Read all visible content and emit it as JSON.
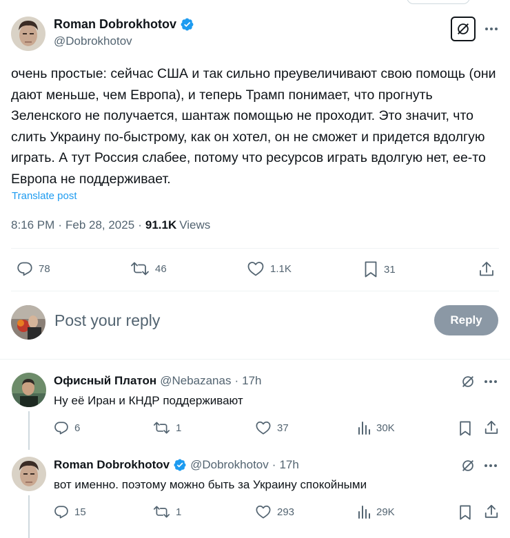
{
  "author": {
    "name": "Roman Dobrokhotov",
    "handle": "@Dobrokhotov"
  },
  "post": {
    "text": "очень простые: сейчас США и так сильно преувеличивают свою помощь (они дают меньше, чем Европа), и теперь Трамп понимает, что прогнуть Зеленского не получается, шантаж помощью не проходит. Это значит, что слить Украину по-быстрому, как он хотел, он не сможет и придется вдолгую играть. А тут Россия слабее, потому что ресурсов играть вдолгую нет, ее-то Европа не поддерживает.",
    "translate_label": "Translate post",
    "time": "8:16 PM",
    "date": "Feb 28, 2025",
    "views_count": "91.1K",
    "views_label": "Views"
  },
  "actions": {
    "replies": "78",
    "reposts": "46",
    "likes": "1.1K",
    "bookmarks": "31"
  },
  "compose": {
    "placeholder": "Post your reply",
    "button_label": "Reply"
  },
  "replies": [
    {
      "name": "Офисный Платон",
      "handle": "@Nebazanas",
      "age": "17h",
      "text": "Ну её Иран и КНДР поддерживают",
      "replies": "6",
      "reposts": "1",
      "likes": "37",
      "views": "30K"
    },
    {
      "name": "Roman Dobrokhotov",
      "handle": "@Dobrokhotov",
      "age": "17h",
      "text": "вот именно. поэтому можно быть за Украину спокойными",
      "replies": "15",
      "reposts": "1",
      "likes": "293",
      "views": "29K"
    }
  ],
  "colors": {
    "accent": "#1d9bf0",
    "muted": "#536471",
    "text": "#0f1419",
    "reply_button": "#8b98a5"
  }
}
